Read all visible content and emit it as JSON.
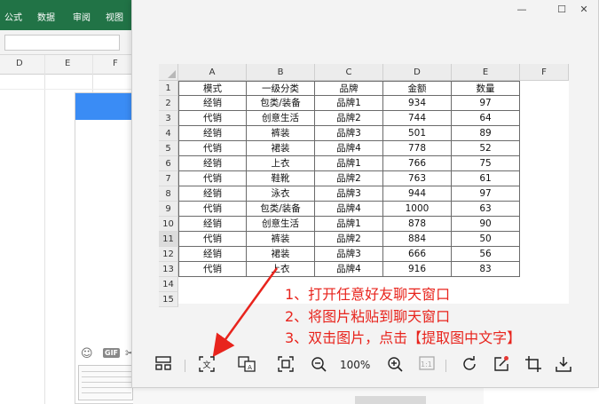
{
  "excel": {
    "ribbon_tabs": [
      "公式",
      "数据",
      "审阅",
      "视图"
    ],
    "columns": [
      "D",
      "E",
      "F"
    ]
  },
  "viewer": {
    "window_controls": {
      "minimize": "—",
      "maximize": "☐",
      "close": "✕"
    },
    "sheet": {
      "column_letters": [
        "A",
        "B",
        "C",
        "D",
        "E",
        "F"
      ],
      "row_numbers": [
        "1",
        "2",
        "3",
        "4",
        "5",
        "6",
        "7",
        "8",
        "9",
        "10",
        "11",
        "12",
        "13",
        "14",
        "15"
      ],
      "header": [
        "模式",
        "一级分类",
        "品牌",
        "金额",
        "数量"
      ],
      "rows": [
        [
          "经销",
          "包类/装备",
          "品牌1",
          "934",
          "97"
        ],
        [
          "代销",
          "创意生活",
          "品牌2",
          "744",
          "64"
        ],
        [
          "经销",
          "裤装",
          "品牌3",
          "501",
          "89"
        ],
        [
          "代销",
          "裙装",
          "品牌4",
          "778",
          "52"
        ],
        [
          "经销",
          "上衣",
          "品牌1",
          "766",
          "75"
        ],
        [
          "代销",
          "鞋靴",
          "品牌2",
          "763",
          "61"
        ],
        [
          "经销",
          "泳衣",
          "品牌3",
          "944",
          "97"
        ],
        [
          "代销",
          "包类/装备",
          "品牌4",
          "1000",
          "63"
        ],
        [
          "经销",
          "创意生活",
          "品牌1",
          "878",
          "90"
        ],
        [
          "代销",
          "裤装",
          "品牌2",
          "884",
          "50"
        ],
        [
          "经销",
          "裙装",
          "品牌3",
          "666",
          "56"
        ],
        [
          "代销",
          "上衣",
          "品牌4",
          "916",
          "83"
        ]
      ]
    },
    "instructions": [
      "1、打开任意好友聊天窗口",
      "2、将图片粘贴到聊天窗口",
      "3、双击图片，点击【提取图中文字】"
    ],
    "zoom_level": "100%",
    "toolbar_icons": [
      "layout-icon",
      "extract-text-icon",
      "translate-icon",
      "fit-screen-icon",
      "zoom-out-icon",
      "zoom-in-icon",
      "actual-size-icon",
      "rotate-icon",
      "edit-icon",
      "crop-icon",
      "download-icon"
    ],
    "actual_size_label": "1:1"
  },
  "chat": {
    "gif_label": "GIF"
  },
  "colors": {
    "excel_green": "#217346",
    "instruction_red": "#e8241d",
    "chat_blue": "#3a8cf5"
  }
}
